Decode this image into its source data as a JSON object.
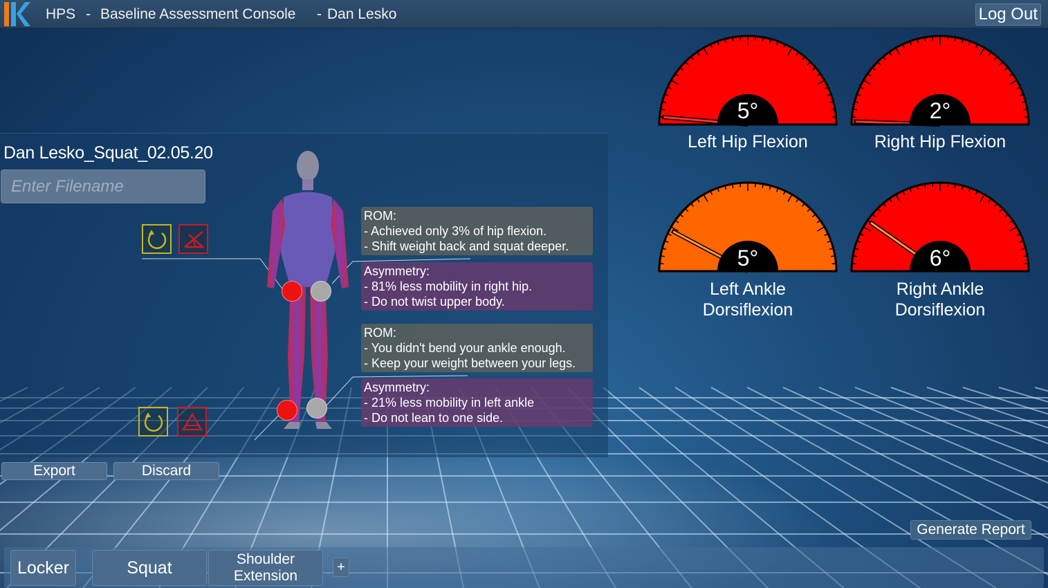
{
  "header": {
    "app": "HPS",
    "sep1": "-",
    "console": "Baseline Assessment Console",
    "sep2": "-",
    "user": "Dan Lesko",
    "logout": "Log Out"
  },
  "assessment": {
    "file_title": "Dan Lesko_Squat_02.05.20",
    "filename_placeholder": "Enter Filename",
    "hip_feedback": {
      "rom_title": "ROM:",
      "rom_lines": [
        "- Achieved only 3% of hip flexion.",
        "- Shift weight back and squat deeper."
      ],
      "asym_title": "Asymmetry:",
      "asym_lines": [
        "- 81% less mobility in right hip.",
        "- Do not twist upper body."
      ]
    },
    "ankle_feedback": {
      "rom_title": "ROM:",
      "rom_lines": [
        "- You didn't bend your ankle enough.",
        "- Keep your weight between your legs."
      ],
      "asym_title": "Asymmetry:",
      "asym_lines": [
        "- 21% less mobility in left ankle",
        "- Do not lean to one side."
      ]
    },
    "export_label": "Export",
    "discard_label": "Discard"
  },
  "gauges": [
    {
      "label": "Left Hip Flexion",
      "value": "5°",
      "color": "#ff0000",
      "needle_deg": 5
    },
    {
      "label": "Right Hip Flexion",
      "value": "2°",
      "color": "#ff0000",
      "needle_deg": 2
    },
    {
      "label": "Left Ankle Dorsiflexion",
      "label_line1": "Left Ankle",
      "label_line2": "Dorsiflexion",
      "value": "5°",
      "color": "#ff6600",
      "needle_deg": 28
    },
    {
      "label": "Right Ankle Dorsiflexion",
      "label_line1": "Right Ankle",
      "label_line2": "Dorsiflexion",
      "value": "6°",
      "color": "#ff0000",
      "needle_deg": 35
    }
  ],
  "generate_report": "Generate Report",
  "tabs": {
    "locker": "Locker",
    "squat": "Squat",
    "shoulder_line1": "Shoulder",
    "shoulder_line2": "Extension",
    "add": "+"
  },
  "colors": {
    "accent_orange": "#f07a1a",
    "accent_blue": "#3aa0e0",
    "icon_yellow": "#c8b420",
    "icon_red": "#c81e1e"
  }
}
